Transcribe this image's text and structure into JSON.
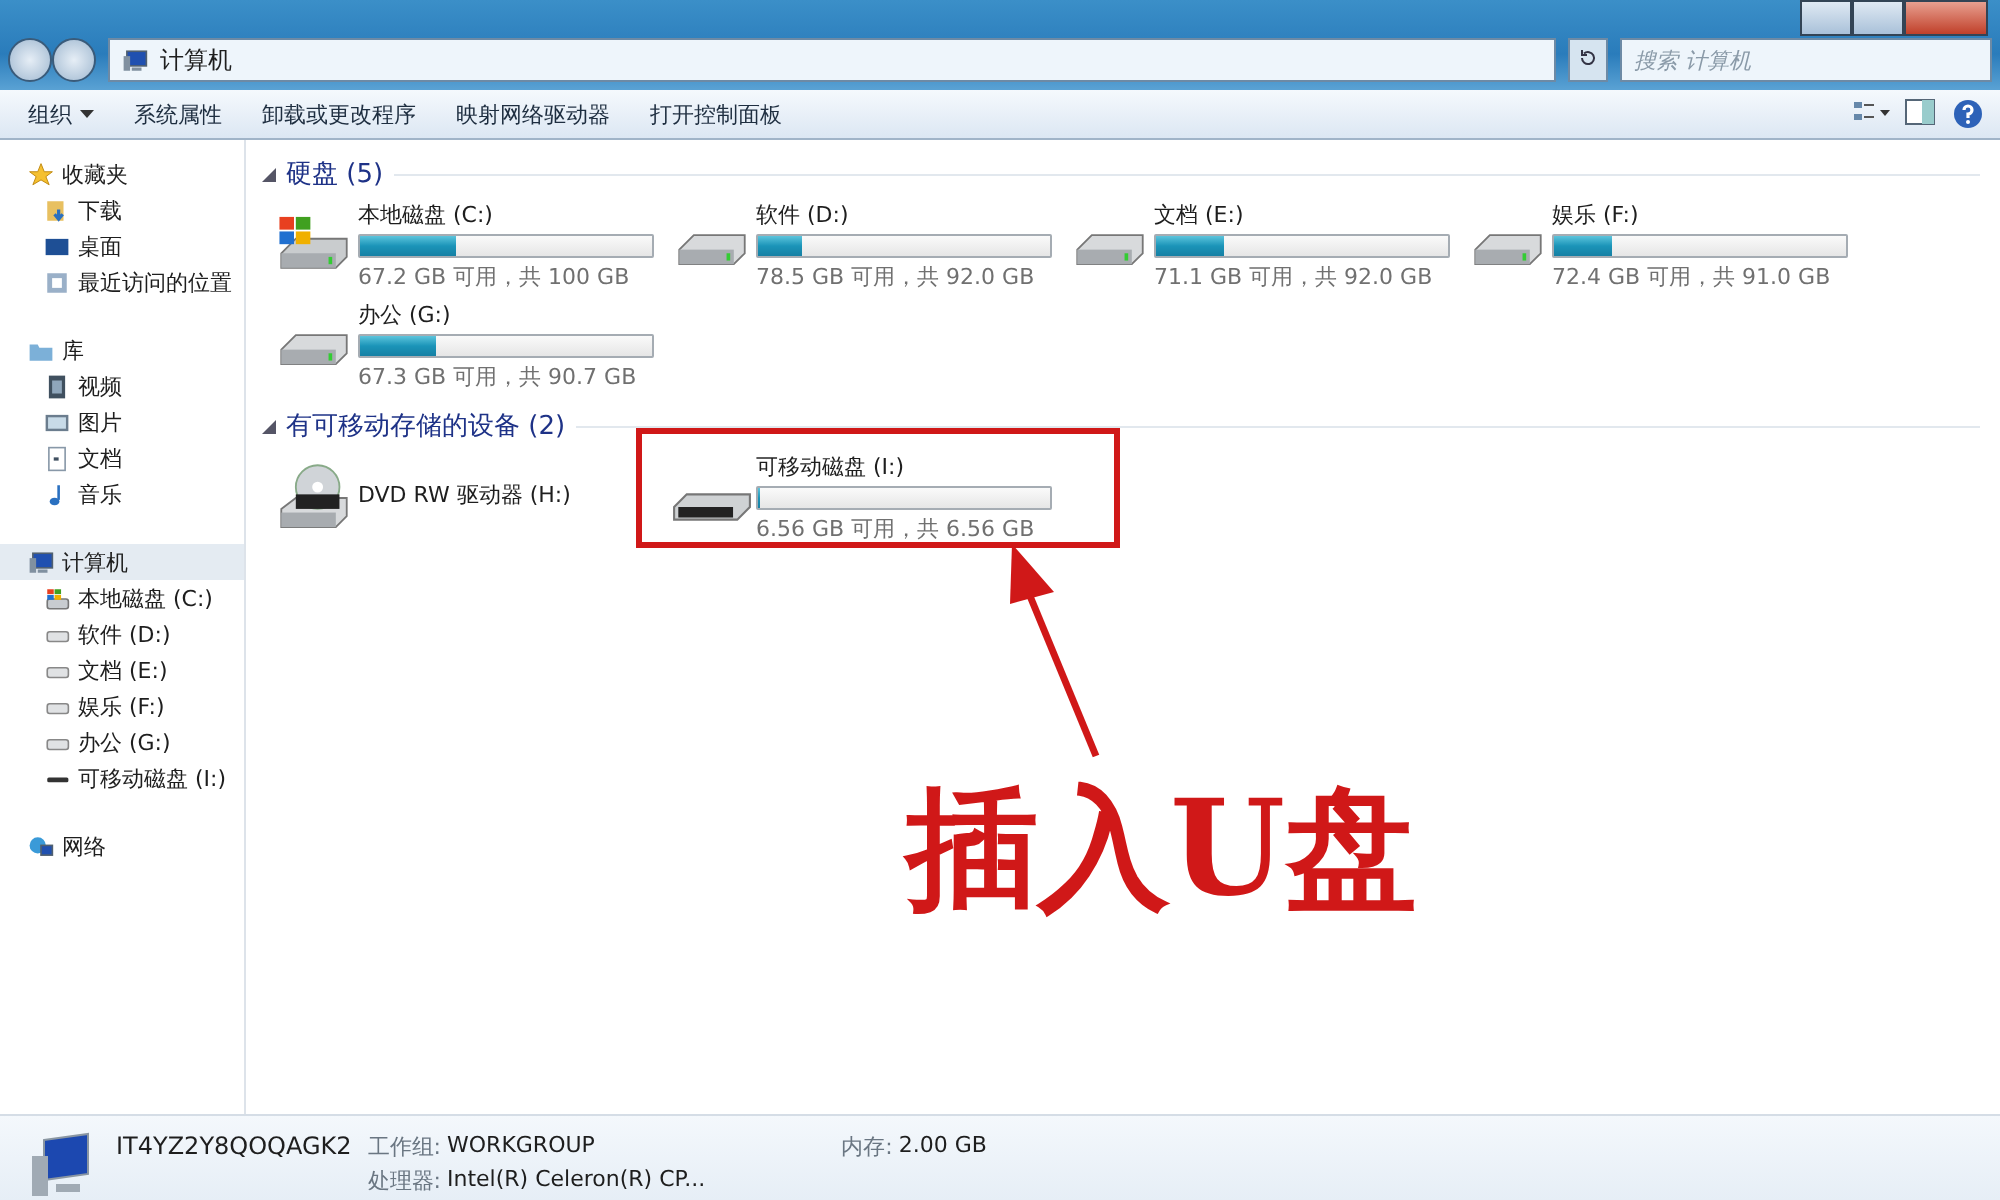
{
  "address_bar": {
    "path": [
      "计算机"
    ]
  },
  "search": {
    "placeholder": "搜索 计算机"
  },
  "toolbar": {
    "items": [
      {
        "label": "组织",
        "dropdown": true
      },
      {
        "label": "系统属性",
        "dropdown": false
      },
      {
        "label": "卸载或更改程序",
        "dropdown": false
      },
      {
        "label": "映射网络驱动器",
        "dropdown": false
      },
      {
        "label": "打开控制面板",
        "dropdown": false
      }
    ]
  },
  "sidebar": {
    "groups": [
      {
        "label": "收藏夹",
        "kind": "star",
        "selected": false,
        "children": [
          {
            "label": "下载",
            "kind": "download",
            "selected": false
          },
          {
            "label": "桌面",
            "kind": "desktop",
            "selected": false
          },
          {
            "label": "最近访问的位置",
            "kind": "recent",
            "selected": false
          }
        ]
      },
      {
        "label": "库",
        "kind": "library",
        "selected": false,
        "children": [
          {
            "label": "视频",
            "kind": "video",
            "selected": false
          },
          {
            "label": "图片",
            "kind": "picture",
            "selected": false
          },
          {
            "label": "文档",
            "kind": "document",
            "selected": false
          },
          {
            "label": "音乐",
            "kind": "music",
            "selected": false
          }
        ]
      },
      {
        "label": "计算机",
        "kind": "computer",
        "selected": true,
        "children": [
          {
            "label": "本地磁盘 (C:)",
            "kind": "windows",
            "selected": false
          },
          {
            "label": "软件 (D:)",
            "kind": "drive",
            "selected": false
          },
          {
            "label": "文档 (E:)",
            "kind": "drive",
            "selected": false
          },
          {
            "label": "娱乐 (F:)",
            "kind": "drive",
            "selected": false
          },
          {
            "label": "办公 (G:)",
            "kind": "drive",
            "selected": false
          },
          {
            "label": "可移动磁盘 (I:)",
            "kind": "usb",
            "selected": false
          }
        ]
      },
      {
        "label": "网络",
        "kind": "network",
        "selected": false
      }
    ]
  },
  "sections": [
    {
      "title": "硬盘 (5)",
      "drives": [
        {
          "name": "本地磁盘 (C:)",
          "kind": "windows",
          "level": 0.33,
          "usage": "67.2 GB 可用，共 100 GB",
          "annotated": false
        },
        {
          "name": "软件 (D:)",
          "kind": "drive",
          "level": 0.15,
          "usage": "78.5 GB 可用，共 92.0 GB",
          "annotated": false
        },
        {
          "name": "文档 (E:)",
          "kind": "drive",
          "level": 0.23,
          "usage": "71.1 GB 可用，共 92.0 GB",
          "annotated": false
        },
        {
          "name": "娱乐 (F:)",
          "kind": "drive",
          "level": 0.2,
          "usage": "72.4 GB 可用，共 91.0 GB",
          "annotated": false
        },
        {
          "name": "办公 (G:)",
          "kind": "drive",
          "level": 0.26,
          "usage": "67.3 GB 可用，共 90.7 GB",
          "annotated": false
        }
      ]
    },
    {
      "title": "有可移动存储的设备 (2)",
      "drives": [
        {
          "name": "DVD RW 驱动器 (H:)",
          "kind": "dvd",
          "annotated": false
        },
        {
          "name": "可移动磁盘 (I:)",
          "kind": "usb",
          "level": 0,
          "usage": "6.56 GB 可用，共 6.56 GB",
          "annotated": true
        }
      ]
    }
  ],
  "annotation": {
    "text": "插入U盘"
  },
  "status": {
    "computer_name": "IT4YZ2Y8QOQAGK2",
    "fields": [
      {
        "label": "工作组:",
        "value": "WORKGROUP"
      },
      {
        "label": "内存:",
        "value": "2.00 GB"
      },
      {
        "label": "处理器:",
        "value": "Intel(R) Celeron(R) CP..."
      }
    ]
  }
}
